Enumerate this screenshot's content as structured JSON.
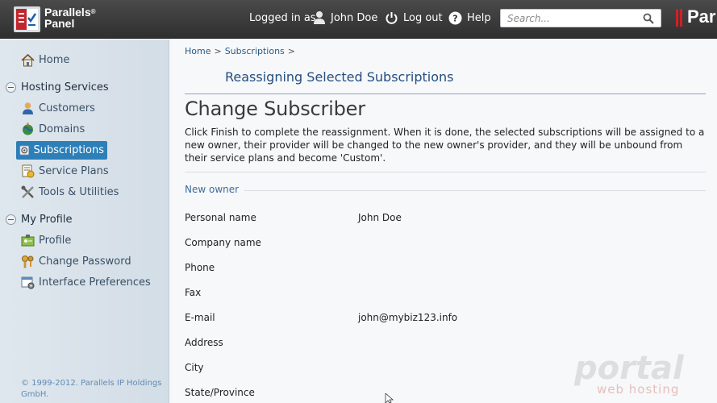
{
  "header": {
    "logo_line1": "Parallels",
    "logo_reg": "®",
    "logo_line2": "Panel",
    "logged_in_as": "Logged in as",
    "user_name": "John Doe",
    "logout": "Log out",
    "help": "Help",
    "search_placeholder": "Search...",
    "brand_word": "Par"
  },
  "sidebar": {
    "home": "Home",
    "hosting_section": "Hosting Services",
    "customers": "Customers",
    "domains": "Domains",
    "subscriptions": "Subscriptions",
    "service_plans": "Service Plans",
    "tools": "Tools & Utilities",
    "profile_section": "My Profile",
    "profile": "Profile",
    "change_password": "Change Password",
    "interface_prefs": "Interface Preferences",
    "copyright": "© 1999-2012. Parallels IP Holdings GmbH."
  },
  "main": {
    "breadcrumb": [
      "Home",
      "Subscriptions"
    ],
    "breadcrumb_sep": ">",
    "page_heading": "Reassigning Selected Subscriptions",
    "title": "Change Subscriber",
    "description": "Click Finish to complete the reassignment. When it is done, the selected subscriptions will be assigned to a new owner, their provider will be changed to the new owner's provider, and they will be unbound from their service plans and become 'Custom'.",
    "group_title": "New owner",
    "fields": [
      {
        "label": "Personal name",
        "value": "John Doe"
      },
      {
        "label": "Company name",
        "value": ""
      },
      {
        "label": "Phone",
        "value": ""
      },
      {
        "label": "Fax",
        "value": ""
      },
      {
        "label": "E-mail",
        "value": "john@mybiz123.info"
      },
      {
        "label": "Address",
        "value": ""
      },
      {
        "label": "City",
        "value": ""
      },
      {
        "label": "State/Province",
        "value": ""
      }
    ]
  },
  "watermark": {
    "line1": "portal",
    "line2": "web hosting"
  }
}
